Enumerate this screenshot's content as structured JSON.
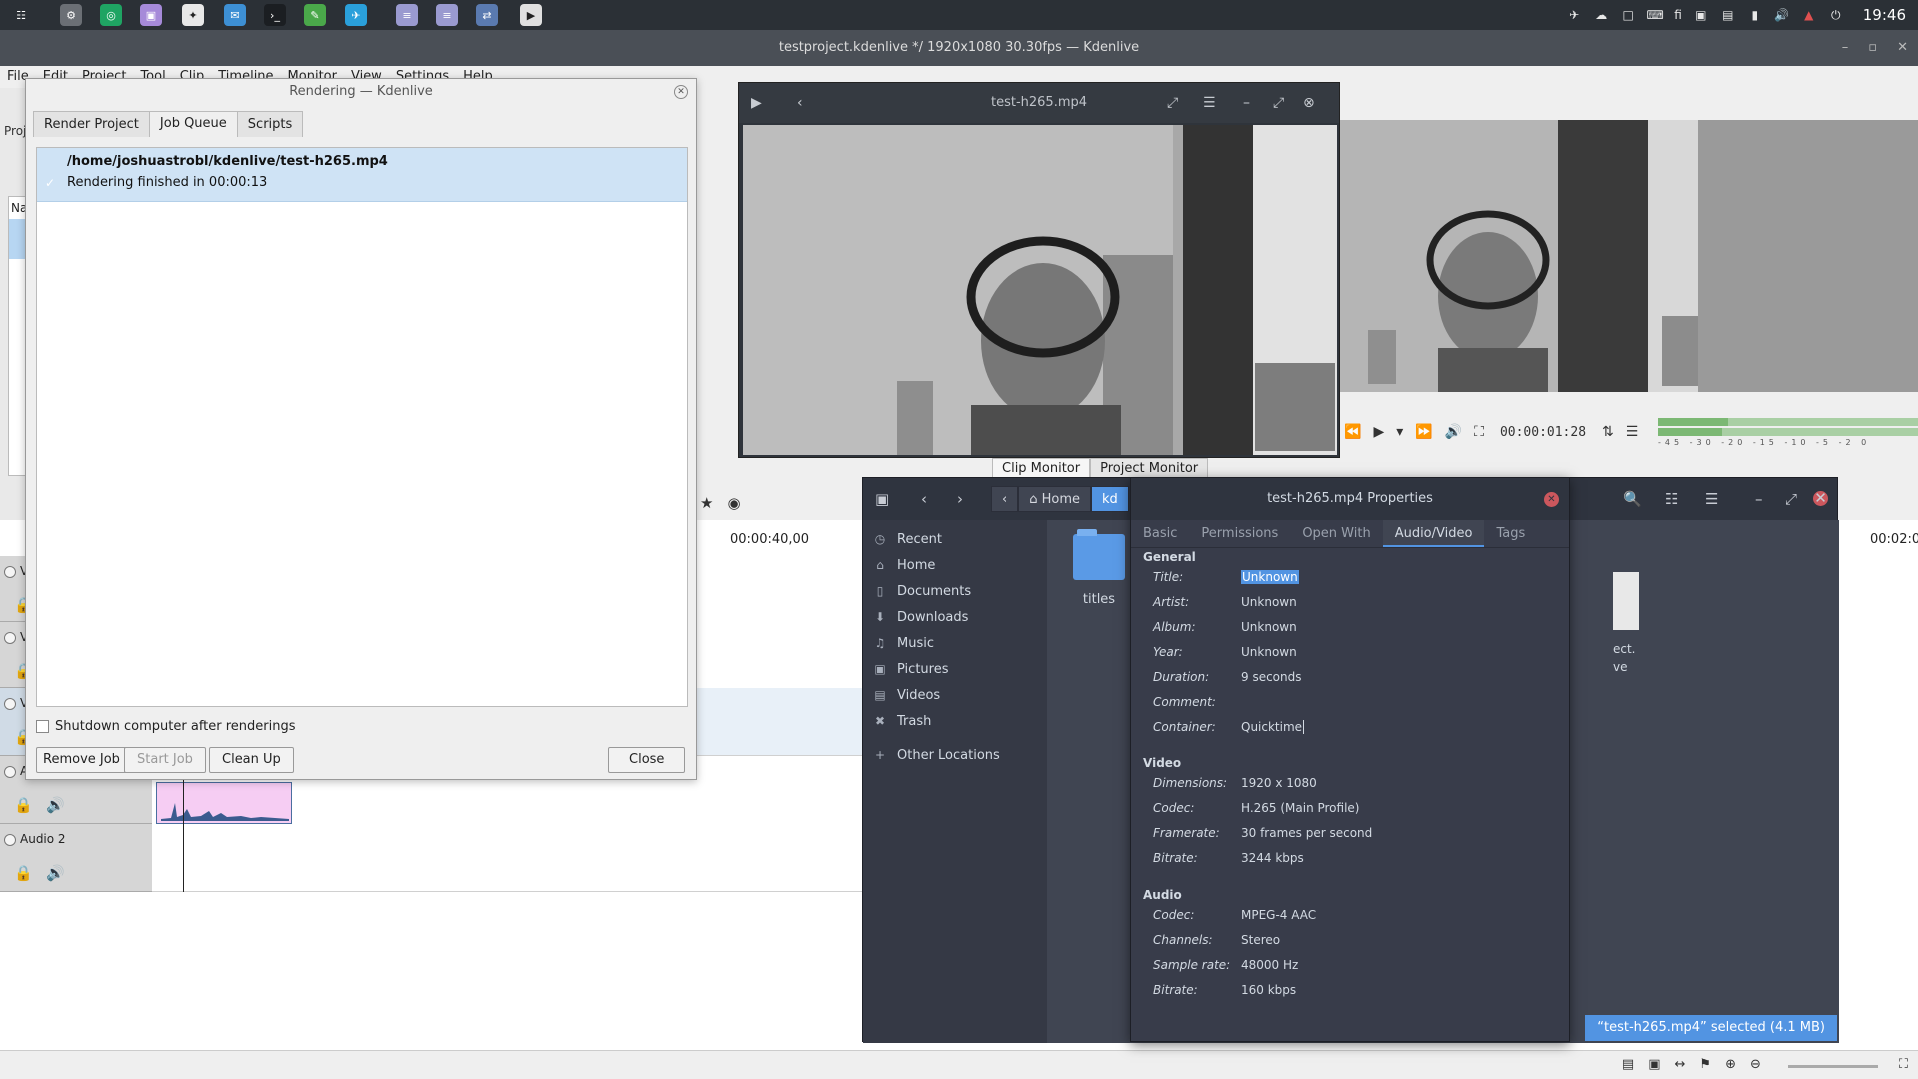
{
  "top_panel": {
    "launchers": [
      {
        "icon": "app-grid-icon",
        "color": "#2b3036"
      },
      {
        "icon": "settings-app-icon",
        "color": "#6b6f75"
      },
      {
        "icon": "browser-icon",
        "color": "#1fa463"
      },
      {
        "icon": "files-app-icon",
        "color": "#a68ad9"
      },
      {
        "icon": "github-desktop-icon",
        "color": "#e8e8e8"
      },
      {
        "icon": "mail-app-icon",
        "color": "#3d8fd4"
      },
      {
        "icon": "terminal-app-icon",
        "color": "#1b1e22"
      },
      {
        "icon": "editor-app-icon",
        "color": "#4aa84a"
      },
      {
        "icon": "telegram-app-icon",
        "color": "#2aa0db"
      },
      {
        "icon": "notes-app-icon",
        "color": "#9a9ad0"
      },
      {
        "icon": "notes2-app-icon",
        "color": "#9a9ad0"
      },
      {
        "icon": "kdenlive-app-icon",
        "color": "#5a7ab0"
      },
      {
        "icon": "media-player-app-icon",
        "color": "#e0e0e0"
      }
    ],
    "keyboard_layout": "fi",
    "clock": "19:46"
  },
  "main_window": {
    "title": "testproject.kdenlive */ 1920x1080 30.30fps — Kdenlive",
    "menu": [
      "File",
      "Edit",
      "Project",
      "Tool",
      "Clip",
      "Timeline",
      "Monitor",
      "View",
      "Settings",
      "Help"
    ],
    "project_label": "Proj",
    "bin_column_label": "Na",
    "monitor_tabs": [
      "Clip Monitor",
      "Project Monitor"
    ],
    "timecode": "00:00:01:28",
    "meter_scale": "-45 -30 -20 -15 -10 -5 -2 0",
    "timeline": {
      "ruler_times": [
        "00:00:40,00",
        "00:02:0"
      ],
      "tracks": [
        {
          "name": "V",
          "kind": "video"
        },
        {
          "name": "V",
          "kind": "video"
        },
        {
          "name": "V",
          "kind": "video"
        },
        {
          "name": "A",
          "kind": "audio"
        },
        {
          "name": "Audio 2",
          "kind": "audio"
        }
      ]
    }
  },
  "render_dialog": {
    "title": "Rendering — Kdenlive",
    "tabs": [
      "Render Project",
      "Job Queue",
      "Scripts"
    ],
    "active_tab": "Job Queue",
    "job": {
      "path": "/home/joshuastrobl/kdenlive/test-h265.mp4",
      "status": "Rendering finished in 00:00:13"
    },
    "shutdown_label": "Shutdown computer after renderings",
    "buttons": {
      "remove": "Remove Job",
      "start": "Start Job",
      "clean": "Clean Up",
      "close": "Close"
    }
  },
  "player": {
    "title": "test-h265.mp4"
  },
  "files": {
    "path": [
      "Home",
      "kd"
    ],
    "sidebar": [
      {
        "label": "Recent",
        "icon": "clock-icon"
      },
      {
        "label": "Home",
        "icon": "home-icon"
      },
      {
        "label": "Documents",
        "icon": "document-icon"
      },
      {
        "label": "Downloads",
        "icon": "download-icon"
      },
      {
        "label": "Music",
        "icon": "music-icon"
      },
      {
        "label": "Pictures",
        "icon": "camera-icon"
      },
      {
        "label": "Videos",
        "icon": "video-icon"
      },
      {
        "label": "Trash",
        "icon": "trash-icon"
      },
      {
        "label": "Other Locations",
        "icon": "plus-icon"
      }
    ],
    "folder_label": "titles",
    "partial_file_label_1": "ect.",
    "partial_file_label_2": "ve",
    "selection_status": "“test-h265.mp4” selected (4.1 MB)"
  },
  "properties": {
    "title": "test-h265.mp4 Properties",
    "tabs": [
      "Basic",
      "Permissions",
      "Open With",
      "Audio/Video",
      "Tags"
    ],
    "active_tab": "Audio/Video",
    "general": {
      "heading": "General",
      "rows": [
        {
          "k": "Title:",
          "v": "Unknown"
        },
        {
          "k": "Artist:",
          "v": "Unknown"
        },
        {
          "k": "Album:",
          "v": "Unknown"
        },
        {
          "k": "Year:",
          "v": "Unknown"
        },
        {
          "k": "Duration:",
          "v": "9 seconds"
        },
        {
          "k": "Comment:",
          "v": ""
        },
        {
          "k": "Container:",
          "v": "Quicktime"
        }
      ]
    },
    "video": {
      "heading": "Video",
      "rows": [
        {
          "k": "Dimensions:",
          "v": "1920 x 1080"
        },
        {
          "k": "Codec:",
          "v": "H.265 (Main Profile)"
        },
        {
          "k": "Framerate:",
          "v": "30 frames per second"
        },
        {
          "k": "Bitrate:",
          "v": "3244 kbps"
        }
      ]
    },
    "audio": {
      "heading": "Audio",
      "rows": [
        {
          "k": "Codec:",
          "v": "MPEG-4 AAC"
        },
        {
          "k": "Channels:",
          "v": "Stereo"
        },
        {
          "k": "Sample rate:",
          "v": "48000 Hz"
        },
        {
          "k": "Bitrate:",
          "v": "160 kbps"
        }
      ]
    }
  },
  "colors": {
    "accent": "#5294e2",
    "dark_bg": "#383c4a",
    "job_selected": "#cfe3f5",
    "audio_clip": "#f6cdf3"
  }
}
